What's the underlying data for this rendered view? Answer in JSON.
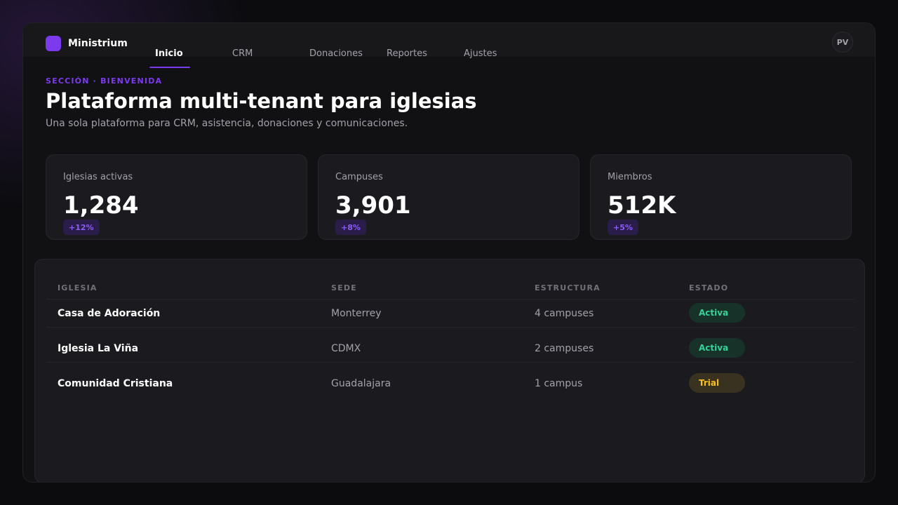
{
  "app": {
    "name": "Ministrium",
    "user_initials": "PV"
  },
  "nav": {
    "tabs": [
      {
        "label": "Inicio",
        "active": true
      },
      {
        "label": "CRM",
        "active": false
      },
      {
        "label": "Donaciones",
        "active": false
      },
      {
        "label": "Reportes",
        "active": false
      },
      {
        "label": "Ajustes",
        "active": false
      }
    ]
  },
  "header": {
    "eyebrow": "SECCIÓN · BIENVENIDA",
    "title": "Plataforma multi-tenant para iglesias",
    "subtitle": "Una sola plataforma para CRM, asistencia, donaciones y comunicaciones."
  },
  "stats": [
    {
      "label": "Iglesias activas",
      "value": "1,284",
      "delta": "+12%"
    },
    {
      "label": "Campuses",
      "value": "3,901",
      "delta": "+8%"
    },
    {
      "label": "Miembros",
      "value": "512K",
      "delta": "+5%"
    }
  ],
  "table": {
    "columns": [
      "IGLESIA",
      "SEDE",
      "ESTRUCTURA",
      "ESTADO"
    ],
    "rows": [
      {
        "iglesia": "Casa de Adoración",
        "sede": "Monterrey",
        "estructura": "4 campuses",
        "estado": "Activa",
        "status_type": "active"
      },
      {
        "iglesia": "Iglesia La Viña",
        "sede": "CDMX",
        "estructura": "2 campuses",
        "estado": "Activa",
        "status_type": "active"
      },
      {
        "iglesia": "Comunidad Cristiana",
        "sede": "Guadalajara",
        "estructura": "1 campus",
        "estado": "Trial",
        "status_type": "trial"
      }
    ]
  },
  "colors": {
    "accent": "#7c3aed",
    "status_active": "#34d399",
    "status_trial": "#fbbf24"
  }
}
